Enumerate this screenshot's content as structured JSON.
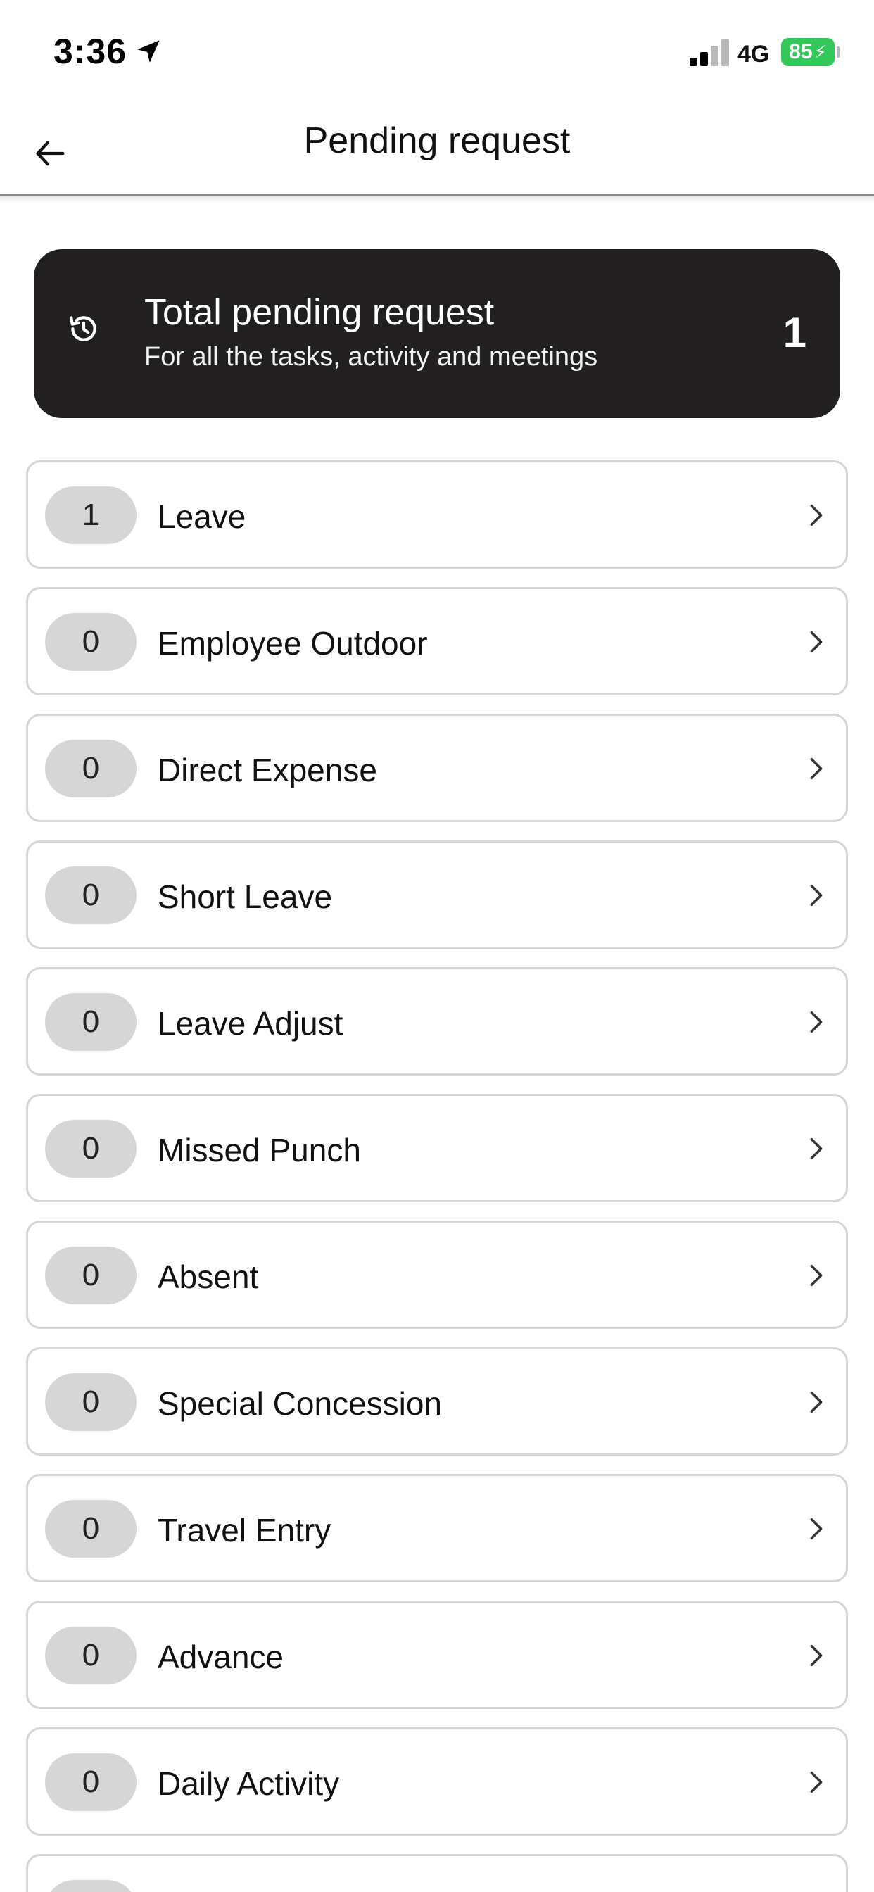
{
  "status_bar": {
    "time": "3:36",
    "network": "4G",
    "battery": "85",
    "location_icon": "location-arrow-icon",
    "battery_color": "#34c759"
  },
  "header": {
    "title": "Pending request",
    "back_icon": "arrow-left-icon"
  },
  "summary": {
    "title": "Total pending request",
    "subtitle": "For all the tasks, activity and meetings",
    "count": "1",
    "icon": "history-icon",
    "background": "#221f20"
  },
  "requests": [
    {
      "count": "1",
      "label": "Leave"
    },
    {
      "count": "0",
      "label": "Employee Outdoor"
    },
    {
      "count": "0",
      "label": "Direct Expense"
    },
    {
      "count": "0",
      "label": "Short Leave"
    },
    {
      "count": "0",
      "label": "Leave Adjust"
    },
    {
      "count": "0",
      "label": "Missed Punch"
    },
    {
      "count": "0",
      "label": "Absent"
    },
    {
      "count": "0",
      "label": "Special Concession"
    },
    {
      "count": "0",
      "label": "Travel Entry"
    },
    {
      "count": "0",
      "label": "Advance"
    },
    {
      "count": "0",
      "label": "Daily Activity"
    },
    {
      "count": "",
      "label": ""
    }
  ]
}
